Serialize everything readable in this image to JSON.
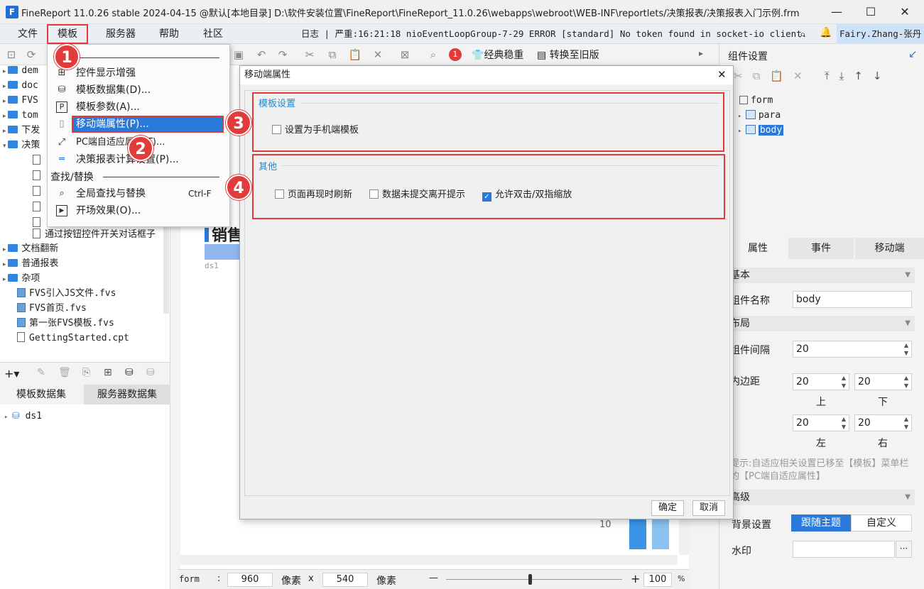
{
  "window": {
    "logo": "F",
    "title": "FineReport 11.0.26 stable 2024-04-15 @默认[本地目录]    D:\\软件安装位置\\FineReport\\FineReport_11.0.26\\webapps\\webroot\\WEB-INF\\reportlets/决策报表/决策报表入门示例.frm",
    "minimize": "—",
    "maximize": "☐",
    "close": "✕"
  },
  "menubar": {
    "items": [
      "文件",
      "模板",
      "服务器",
      "帮助",
      "社区"
    ],
    "log": "日志 | 严重:16:21:18 nioEventLoopGroup-7-29 ERROR [standard] No token found in socket-io client.",
    "user": "Fairy.Zhang-张丹"
  },
  "toolbar": {
    "classic": "经典稳重",
    "to_old": "转换至旧版",
    "badge": "1"
  },
  "template_menu": {
    "items": [
      {
        "icon": "⊞",
        "label": "控件显示增强"
      },
      {
        "icon": "⛁",
        "label": "模板数据集(D)..."
      },
      {
        "icon": "P",
        "label": "模板参数(A)..."
      },
      {
        "icon": "▯",
        "label": "移动端属性(P)..."
      },
      {
        "icon": "⤢",
        "label": "PC端自适应属性(T)..."
      },
      {
        "icon": "═",
        "label": "决策报表计算设置(P)..."
      }
    ],
    "group_label": "查找/替换",
    "find": {
      "icon": "⌕",
      "label": "全局查找与替换",
      "shortcut": "Ctrl-F"
    },
    "opening": {
      "icon": "▶",
      "label": "开场效果(O)..."
    }
  },
  "tree": {
    "folders_top": [
      "dem",
      "doc",
      "FVS",
      "tom",
      "下发",
      "决策"
    ],
    "last_file": "通过按钮控件开关对话框子",
    "folders_bottom": [
      "文档翻新",
      "普通报表",
      "杂项"
    ],
    "files": [
      "FVS引入JS文件.fvs",
      "FVS首页.fvs",
      "第一张FVS模板.fvs",
      "GettingStarted.cpt"
    ]
  },
  "dataset_tabs": [
    "模板数据集",
    "服务器数据集"
  ],
  "datasets": [
    "ds1"
  ],
  "canvas": {
    "heading": "销售",
    "cell": "ds1",
    "axis_value": "10"
  },
  "status": {
    "form": "form",
    "colon": ":",
    "width": "960",
    "unit1": "像素",
    "x": "x",
    "height": "540",
    "unit2": "像素",
    "minus": "—",
    "plus": "+",
    "zoom": "100",
    "pct": "%"
  },
  "dialog": {
    "title": "移动端属性",
    "close": "✕",
    "group1": {
      "title": "模板设置",
      "options": [
        {
          "label": "设置为手机端模板",
          "checked": false
        }
      ]
    },
    "group2": {
      "title": "其他",
      "options": [
        {
          "label": "页面再现时刷新",
          "checked": false
        },
        {
          "label": "数据未提交离开提示",
          "checked": false
        },
        {
          "label": "允许双击/双指缩放",
          "checked": true
        }
      ]
    },
    "ok": "确定",
    "cancel": "取消"
  },
  "right_panel": {
    "title": "组件设置",
    "tree": [
      "form",
      "para",
      "body"
    ],
    "tabs": [
      "属性",
      "事件",
      "移动端"
    ],
    "section_basic": "基本",
    "name_label": "组件名称",
    "name_value": "body",
    "section_layout": "布局",
    "spacing_label": "组件间隔",
    "spacing_value": "20",
    "padding_label": "内边距",
    "pad_top": "20",
    "pad_bottom": "20",
    "pad_left": "20",
    "pad_right": "20",
    "lbl_top": "上",
    "lbl_bottom": "下",
    "lbl_left": "左",
    "lbl_right": "右",
    "hint": "提示:自适应相关设置已移至【模板】菜单栏的【PC端自适应属性】",
    "section_advanced": "高级",
    "bg_label": "背景设置",
    "bg_follow": "跟随主题",
    "bg_custom": "自定义",
    "watermark_label": "水印",
    "watermark_btn": "···"
  },
  "badges": [
    "1",
    "2",
    "3",
    "4"
  ],
  "colors": {
    "accent": "#1e6fd9",
    "annotation": "#e23b3b",
    "group_title": "#1f8ad1"
  }
}
